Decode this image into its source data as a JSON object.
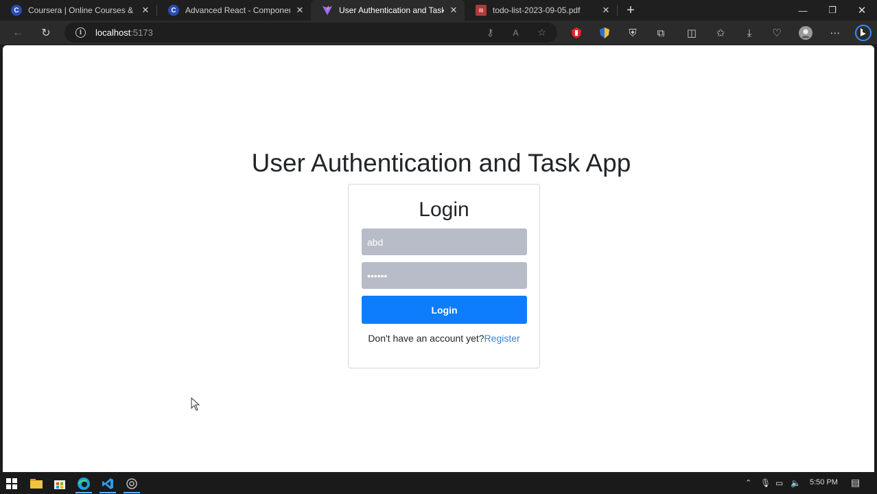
{
  "tabs": [
    {
      "title": "Coursera | Online Courses & Cre",
      "favicon": "coursera-favicon",
      "fav_letter": "C",
      "active": false
    },
    {
      "title": "Advanced React - Components -",
      "favicon": "coursera-favicon",
      "fav_letter": "C",
      "active": false
    },
    {
      "title": "User Authentication and Task Ap",
      "favicon": "vite-favicon",
      "fav_letter": "",
      "active": true
    },
    {
      "title": "todo-list-2023-09-05.pdf",
      "favicon": "pdf-favicon",
      "fav_letter": "",
      "active": false
    }
  ],
  "address": {
    "host": "localhost",
    "port": ":5173"
  },
  "page": {
    "app_title": "User Authentication and Task App",
    "login": {
      "heading": "Login",
      "username_value": "abd",
      "password_value": "••••••",
      "button_label": "Login",
      "prompt_text": "Don't have an account yet?",
      "register_link": "Register"
    }
  },
  "taskbar": {
    "time": "5:50 PM"
  },
  "colors": {
    "primary_button": "#0d7dfd",
    "link": "#3b7fd6",
    "input_bg": "#b8bcc8"
  }
}
